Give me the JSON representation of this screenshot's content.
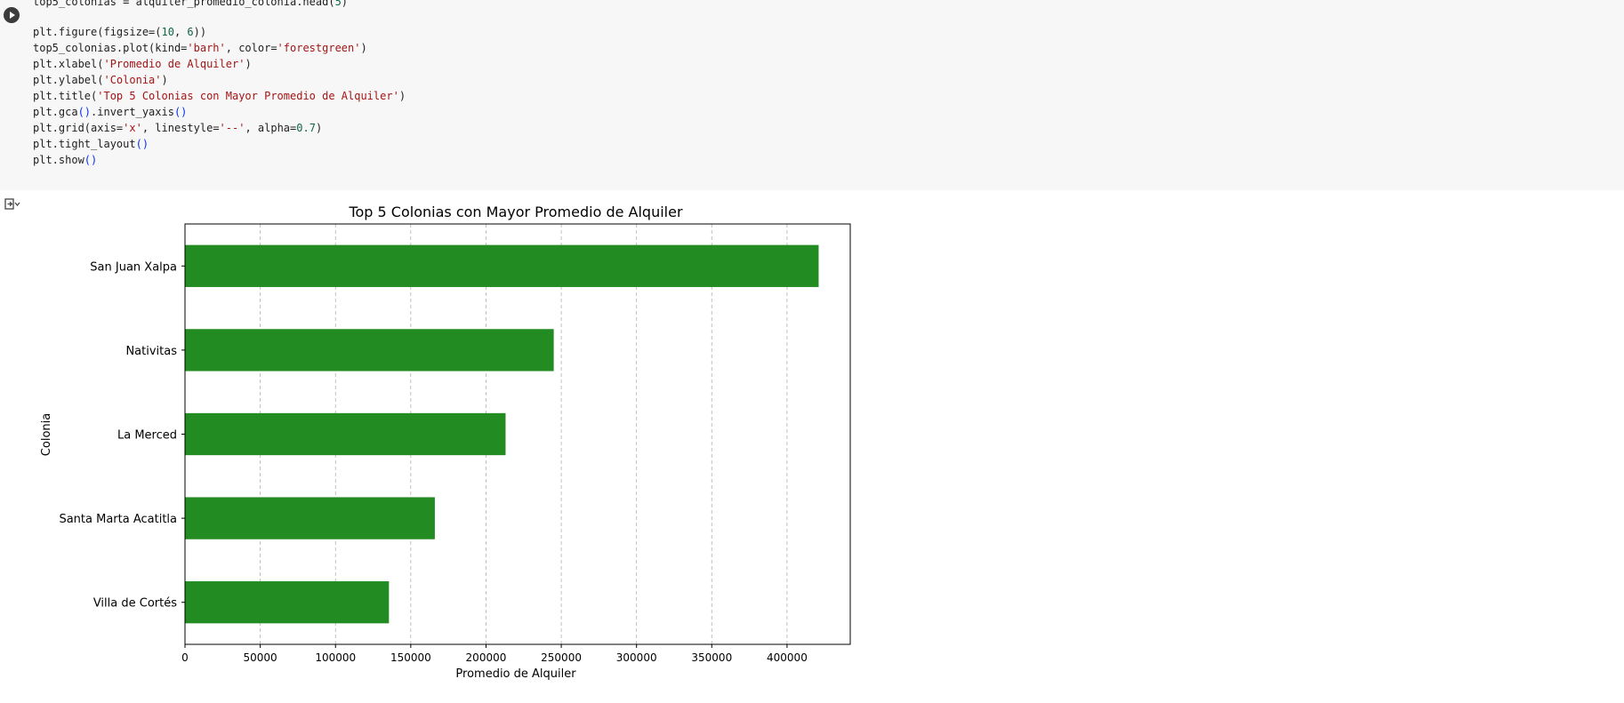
{
  "code_cell": {
    "lines": [
      [
        {
          "t": "top5_colonias = alquiler_promedio_colonia.head("
        },
        {
          "t": "5",
          "c": "n"
        },
        {
          "t": ")"
        }
      ],
      [
        {
          "t": ""
        }
      ],
      [
        {
          "t": "plt.figure(figsize=("
        },
        {
          "t": "10",
          "c": "n"
        },
        {
          "t": ", "
        },
        {
          "t": "6",
          "c": "n"
        },
        {
          "t": "))"
        }
      ],
      [
        {
          "t": "top5_colonias.plot(kind="
        },
        {
          "t": "'barh'",
          "c": "s"
        },
        {
          "t": ", color="
        },
        {
          "t": "'forestgreen'",
          "c": "s"
        },
        {
          "t": ")"
        }
      ],
      [
        {
          "t": "plt.xlabel("
        },
        {
          "t": "'Promedio de Alquiler'",
          "c": "s"
        },
        {
          "t": ")"
        }
      ],
      [
        {
          "t": "plt.ylabel("
        },
        {
          "t": "'Colonia'",
          "c": "s"
        },
        {
          "t": ")"
        }
      ],
      [
        {
          "t": "plt.title("
        },
        {
          "t": "'Top 5 Colonias con Mayor Promedio de Alquiler'",
          "c": "s"
        },
        {
          "t": ")"
        }
      ],
      [
        {
          "t": "plt.gca"
        },
        {
          "t": "()",
          "c": "p"
        },
        {
          "t": ".invert_yaxis"
        },
        {
          "t": "()",
          "c": "p"
        }
      ],
      [
        {
          "t": "plt.grid(axis="
        },
        {
          "t": "'x'",
          "c": "s"
        },
        {
          "t": ", linestyle="
        },
        {
          "t": "'--'",
          "c": "s"
        },
        {
          "t": ", alpha="
        },
        {
          "t": "0.7",
          "c": "n"
        },
        {
          "t": ")"
        }
      ],
      [
        {
          "t": "plt.tight_layout"
        },
        {
          "t": "()",
          "c": "p"
        }
      ],
      [
        {
          "t": "plt.show"
        },
        {
          "t": "()",
          "c": "p"
        }
      ]
    ]
  },
  "chart_data": {
    "type": "bar",
    "orientation": "horizontal",
    "title": "Top 5 Colonias con Mayor Promedio de Alquiler",
    "xlabel": "Promedio de Alquiler",
    "ylabel": "Colonia",
    "categories": [
      "San Juan Xalpa",
      "Nativitas",
      "La Merced",
      "Santa Marta Acatitla",
      "Villa de Cortés"
    ],
    "values": [
      421000,
      245000,
      213000,
      166000,
      135500
    ],
    "xlim": [
      0,
      442000
    ],
    "xticks": [
      0,
      50000,
      100000,
      150000,
      200000,
      250000,
      300000,
      350000,
      400000
    ],
    "xtick_labels": [
      "0",
      "50000",
      "100000",
      "150000",
      "200000",
      "250000",
      "300000",
      "350000",
      "400000"
    ],
    "grid": "x-dashed",
    "bar_color": "#228b22"
  }
}
